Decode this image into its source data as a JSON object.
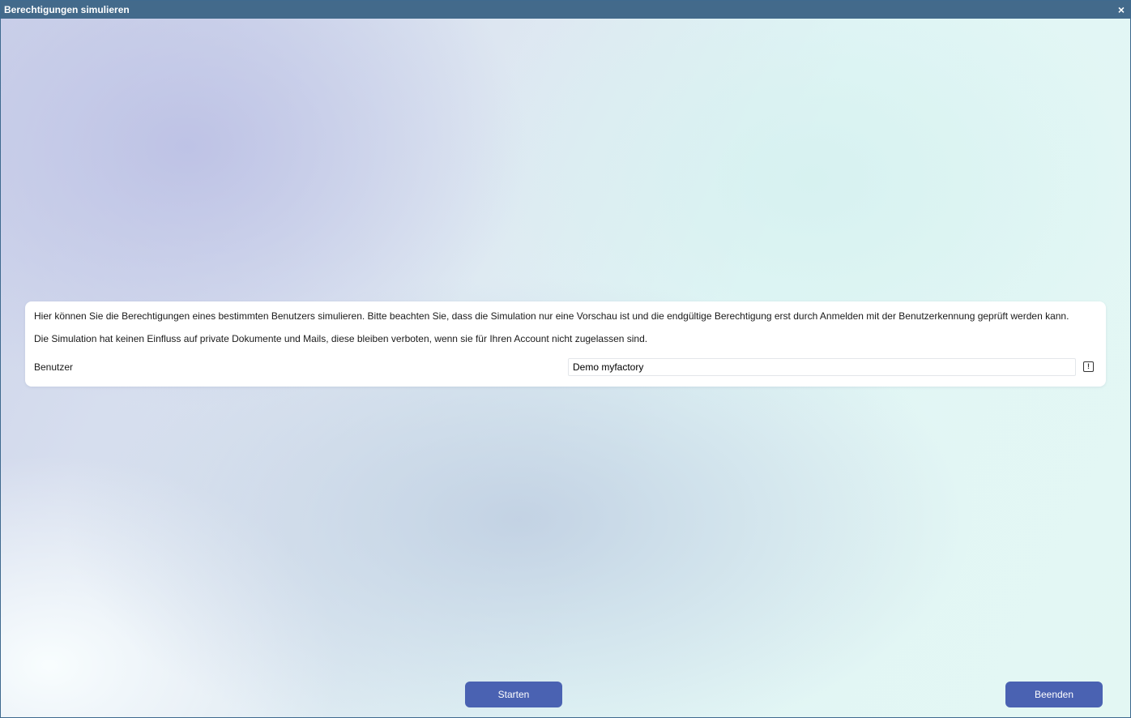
{
  "window": {
    "title": "Berechtigungen simulieren",
    "close_symbol": "×"
  },
  "card": {
    "paragraph_1": "Hier können Sie die Berechtigungen eines bestimmten Benutzers simulieren. Bitte beachten Sie, dass die Simulation nur eine Vorschau ist und die endgültige Berechtigung erst durch Anmelden mit der Benutzerkennung geprüft werden kann.",
    "paragraph_2": "Die Simulation hat keinen Einfluss auf private Dokumente und Mails, diese bleiben verboten, wenn sie für Ihren Account nicht zugelassen sind.",
    "user_label": "Benutzer",
    "user_value": "Demo myfactory",
    "info_symbol": "!"
  },
  "buttons": {
    "start_label": "Starten",
    "end_label": "Beenden"
  },
  "icons": {
    "close": "close-icon",
    "info": "info-icon"
  },
  "colors": {
    "titlebar": "#436a8b",
    "button": "#4a62b2"
  }
}
